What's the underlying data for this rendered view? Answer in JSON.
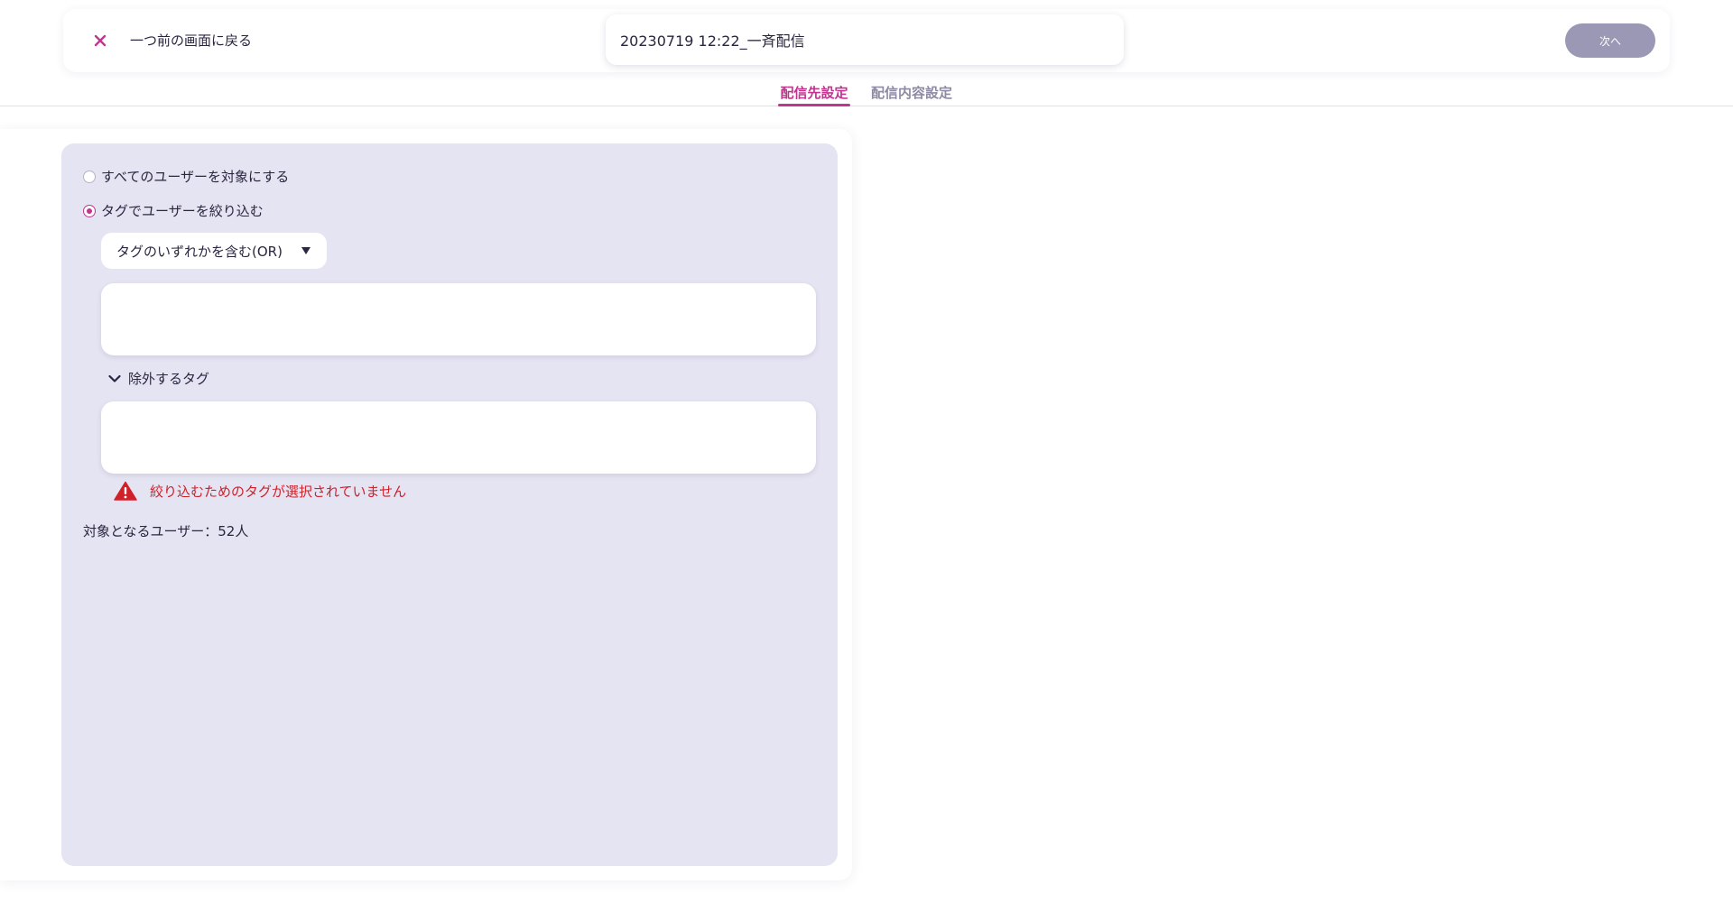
{
  "header": {
    "back_label": "一つ前の画面に戻る",
    "title_value": "20230719 12:22_一斉配信",
    "next_label": "次へ"
  },
  "tabs": [
    {
      "label": "配信先設定",
      "active": true
    },
    {
      "label": "配信内容設定",
      "active": false
    }
  ],
  "targeting": {
    "options": [
      {
        "label": "すべてのユーザーを対象にする",
        "checked": false
      },
      {
        "label": "タグでユーザーを絞り込む",
        "checked": true
      }
    ],
    "match_mode": "タグのいずれかを含む(OR)",
    "include_tags_value": "",
    "exclude_label": "除外するタグ",
    "exclude_tags_value": "",
    "error_message": "絞り込むためのタグが選択されていません",
    "user_count_label": "対象となるユーザー：52人"
  },
  "colors": {
    "accent": "#c2358f",
    "panel": "#e5e4f2",
    "disabled_button": "#9a98b4",
    "error": "#d0202a"
  },
  "icons": {
    "close": "close-icon",
    "caret": "caret-down-icon",
    "chevron": "chevron-down-icon",
    "warning": "warning-icon"
  }
}
